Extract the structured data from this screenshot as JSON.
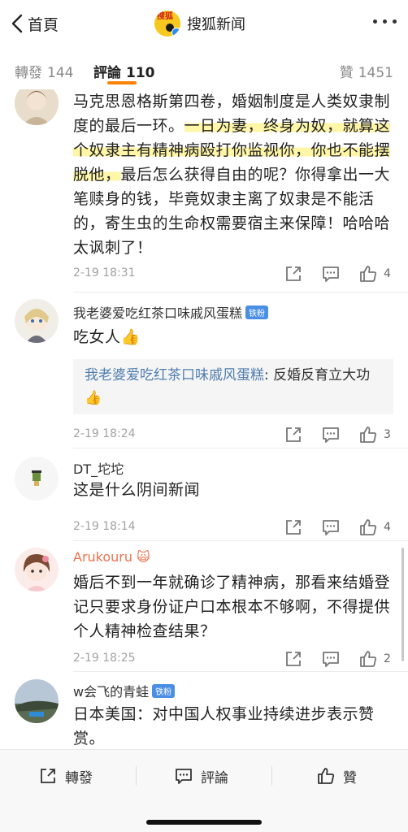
{
  "header": {
    "back_label": "首頁",
    "brand_name": "搜狐新闻",
    "brand_logo_text": "搜狐"
  },
  "tabs": {
    "forward": {
      "label": "轉發",
      "count": "144"
    },
    "comments": {
      "label": "評論",
      "count": "110"
    },
    "likes": {
      "label": "贊",
      "count": "1451"
    }
  },
  "colors": {
    "accent": "#ff8200",
    "link": "#507daf",
    "highlight": "#fff6a8",
    "badge": "#4a8fe3"
  },
  "comments": [
    {
      "name": "",
      "text_before": "马克思恩格斯第四卷，婚姻制度是人类奴隶制度的最后一环。",
      "text_highlight": "一日为妻，终身为奴，就算这个奴隶主有精神病殴打你监视你，你也不能摆脱他，",
      "text_after": "最后怎么获得自由的呢？你得拿出一大笔赎身的钱，毕竟奴隶主离了奴隶是不能活的，寄生虫的生命权需要宿主来保障！哈哈哈太讽刺了！",
      "time": "2-19 18:31",
      "likes": "4"
    },
    {
      "name": "我老婆爱吃红茶口味戚风蛋糕",
      "badge": "铁粉",
      "text": "吃女人👍",
      "reply_name": "我老婆爱吃红茶口味戚风蛋糕",
      "reply_text": ": 反婚反育立大功👍",
      "time": "2-19 18:24",
      "likes": "3"
    },
    {
      "name": "DT_坨坨",
      "text": "这是什么阴间新闻",
      "time": "2-19 18:14",
      "likes": "4"
    },
    {
      "name": "Arukouru",
      "name_emoji": "🙀",
      "text": "婚后不到一年就确诊了精神病，那看来结婚登记只要求身份证户口本根本不够啊，不得提供个人精神检查结果？",
      "time": "2-19 18:25",
      "likes": "2"
    },
    {
      "name": "w会飞的青蛙",
      "badge": "铁粉",
      "text": "日本美国：对中国人权事业持续进步表示赞赏。"
    }
  ],
  "bottom_bar": {
    "forward_label": "轉發",
    "comment_label": "評論",
    "like_label": "贊"
  }
}
